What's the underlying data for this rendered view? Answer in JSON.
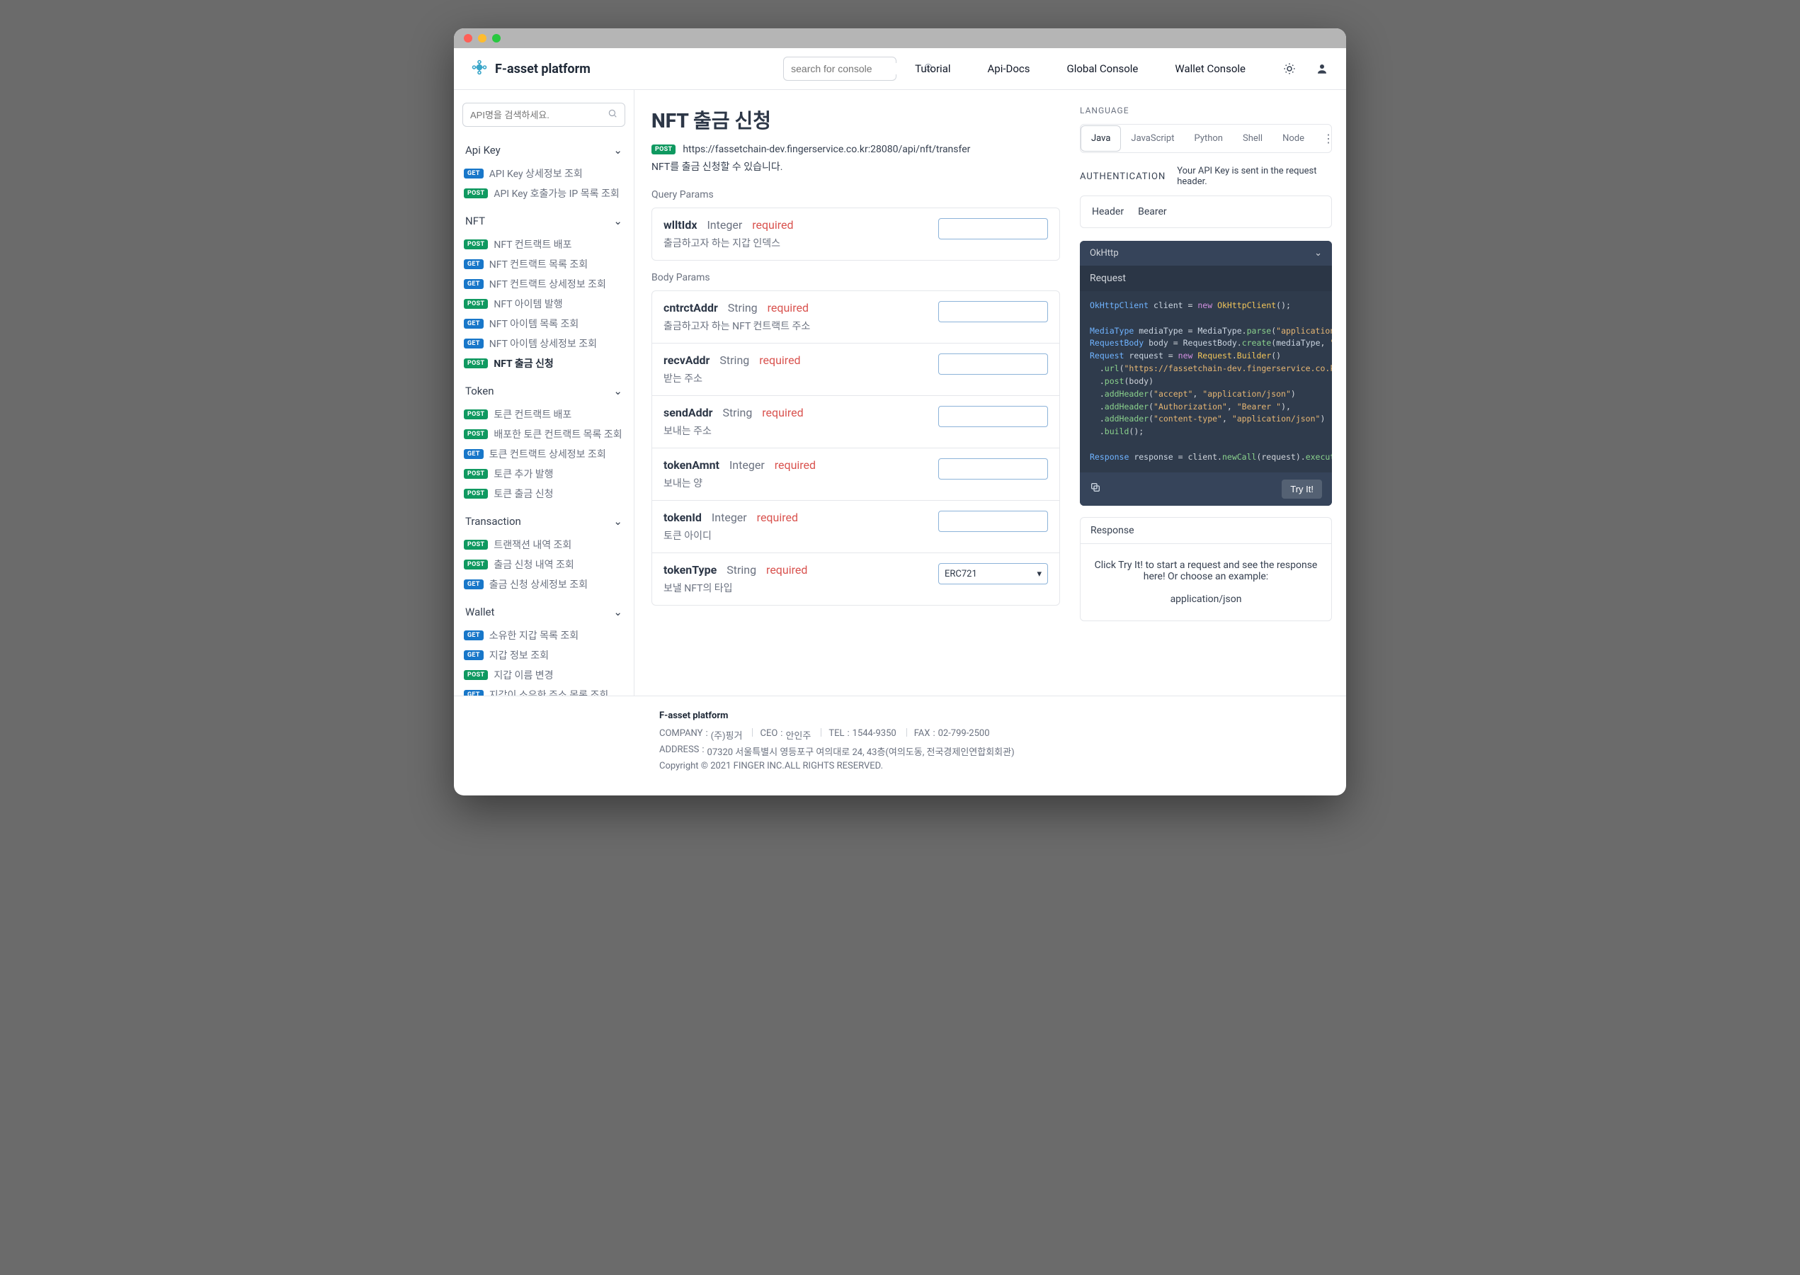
{
  "brand": "F-asset platform",
  "search_console_placeholder": "search for console",
  "nav": [
    "Tutorial",
    "Api-Docs",
    "Global Console",
    "Wallet Console"
  ],
  "sidebar": {
    "search_placeholder": "API명을 검색하세요.",
    "groups": [
      {
        "name": "Api Key",
        "items": [
          {
            "method": "GET",
            "label": "API Key 상세정보 조회"
          },
          {
            "method": "POST",
            "label": "API Key 호출가능 IP 목록 조회"
          }
        ]
      },
      {
        "name": "NFT",
        "items": [
          {
            "method": "POST",
            "label": "NFT 컨트랙트 배포"
          },
          {
            "method": "GET",
            "label": "NFT 컨트랙트 목록 조회"
          },
          {
            "method": "GET",
            "label": "NFT 컨트랙트 상세정보 조회"
          },
          {
            "method": "POST",
            "label": "NFT 아이템 발행"
          },
          {
            "method": "GET",
            "label": "NFT 아이템 목록 조회"
          },
          {
            "method": "GET",
            "label": "NFT 아이템 상세정보 조회"
          },
          {
            "method": "POST",
            "label": "NFT 출금 신청",
            "active": true
          }
        ]
      },
      {
        "name": "Token",
        "items": [
          {
            "method": "POST",
            "label": "토큰 컨트랙트 배포"
          },
          {
            "method": "POST",
            "label": "배포한 토큰 컨트랙트 목록 조회"
          },
          {
            "method": "GET",
            "label": "토큰 컨트랙트 상세정보 조회"
          },
          {
            "method": "POST",
            "label": "토큰 추가 발행"
          },
          {
            "method": "POST",
            "label": "토큰 출금 신청"
          }
        ]
      },
      {
        "name": "Transaction",
        "items": [
          {
            "method": "POST",
            "label": "트랜잭션 내역 조회"
          },
          {
            "method": "POST",
            "label": "출금 신청 내역 조회"
          },
          {
            "method": "GET",
            "label": "출금 신청 상세정보 조회"
          }
        ]
      },
      {
        "name": "Wallet",
        "items": [
          {
            "method": "GET",
            "label": "소유한 지갑 목록 조회"
          },
          {
            "method": "GET",
            "label": "지갑 정보 조회"
          },
          {
            "method": "POST",
            "label": "지갑 이름 변경"
          },
          {
            "method": "GET",
            "label": "지갑이 소유한 주소 목록 조회"
          }
        ]
      }
    ]
  },
  "page": {
    "title": "NFT 출금 신청",
    "method": "POST",
    "url": "https://fassetchain-dev.fingerservice.co.kr:28080/api/nft/transfer",
    "description": "NFT를 출금 신청할 수 있습니다.",
    "sections": {
      "query": "Query Params",
      "body": "Body Params"
    },
    "params": {
      "query": [
        {
          "name": "wlltIdx",
          "type": "Integer",
          "required": "required",
          "desc": "출금하고자 하는 지갑 인덱스"
        }
      ],
      "body": [
        {
          "name": "cntrctAddr",
          "type": "String",
          "required": "required",
          "desc": "출금하고자 하는 NFT 컨트랙트 주소"
        },
        {
          "name": "recvAddr",
          "type": "String",
          "required": "required",
          "desc": "받는 주소"
        },
        {
          "name": "sendAddr",
          "type": "String",
          "required": "required",
          "desc": "보내는 주소"
        },
        {
          "name": "tokenAmnt",
          "type": "Integer",
          "required": "required",
          "desc": "보내는 양"
        },
        {
          "name": "tokenId",
          "type": "Integer",
          "required": "required",
          "desc": "토큰 아이디"
        },
        {
          "name": "tokenType",
          "type": "String",
          "required": "required",
          "desc": "보낼 NFT의 타입",
          "select": "ERC721"
        }
      ]
    }
  },
  "right": {
    "language_heading": "LANGUAGE",
    "lang_tabs": [
      "Java",
      "JavaScript",
      "Python",
      "Shell",
      "Node"
    ],
    "auth_heading": "AUTHENTICATION",
    "auth_text": "Your API Key is sent in the request header.",
    "auth_box": {
      "k": "Header",
      "v": "Bearer"
    },
    "client_label": "OkHttp",
    "request_label": "Request",
    "try_label": "Try It!",
    "response_heading": "Response",
    "response_msg": "Click Try It! to start a request and see the response here! Or choose an example:",
    "response_mime": "application/json"
  },
  "footer": {
    "brand": "F-asset platform",
    "line1": [
      {
        "k": "COMPANY",
        "v": "(주)핑거"
      },
      {
        "k": "CEO",
        "v": "안인주"
      },
      {
        "k": "TEL",
        "v": "1544-9350"
      },
      {
        "k": "FAX",
        "v": "02-799-2500"
      }
    ],
    "addr_k": "ADDRESS",
    "addr_v": "07320 서울특별시 영등포구 여의대로 24, 43층(여의도동, 전국경제인연합회회관)",
    "copy": "Copyright © 2021 FINGER INC.ALL RIGHTS RESERVED."
  }
}
